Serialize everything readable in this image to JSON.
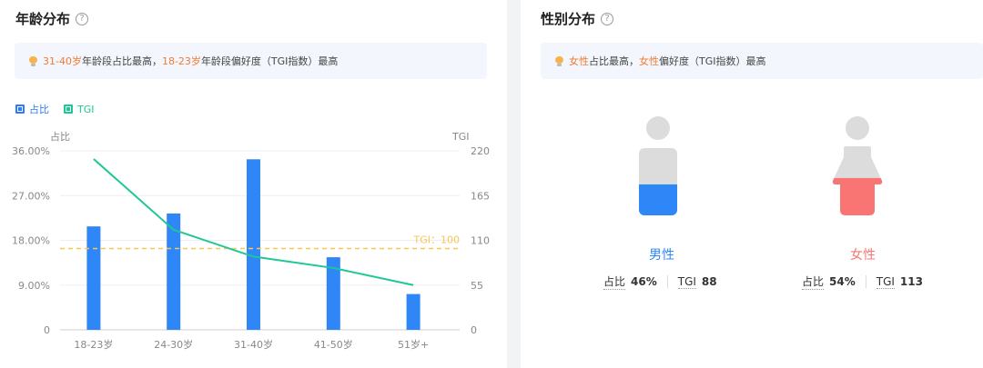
{
  "age_panel": {
    "title": "年龄分布",
    "help_icon": "question-circle-icon",
    "tip": {
      "icon": "lightbulb-icon",
      "hl1": "31-40岁",
      "t1": "年龄段占比最高，",
      "hl2": "18-23岁",
      "t2": "年龄段偏好度（TGI指数）最高"
    },
    "legend": [
      {
        "label": "占比",
        "color": "#2f7cf6"
      },
      {
        "label": "TGI",
        "color": "#1ec796"
      }
    ],
    "left_axis_title": "占比",
    "right_axis_title": "TGI",
    "tgi_ref_label": "TGI：100"
  },
  "gender_panel": {
    "title": "性别分布",
    "help_icon": "question-circle-icon",
    "tip": {
      "icon": "lightbulb-icon",
      "hl1": "女性",
      "t1": "占比最高，",
      "hl2": "女性",
      "t2": "偏好度（TGI指数）最高"
    },
    "male": {
      "label": "男性",
      "share_key": "占比",
      "share": "46%",
      "tgi_key": "TGI",
      "tgi": "88",
      "color": "#2f86f6",
      "share_value": 0.46
    },
    "female": {
      "label": "女性",
      "share_key": "占比",
      "share": "54%",
      "tgi_key": "TGI",
      "tgi": "113",
      "color": "#f87574",
      "share_value": 0.54
    }
  },
  "chart_data": {
    "type": "bar",
    "categories": [
      "18-23岁",
      "24-30岁",
      "31-40岁",
      "41-50岁",
      "51岁+"
    ],
    "series": [
      {
        "name": "占比",
        "type": "bar",
        "axis": "left",
        "color": "#2f86f6",
        "values": [
          20.8,
          23.4,
          34.3,
          14.6,
          7.2
        ]
      },
      {
        "name": "TGI",
        "type": "line",
        "axis": "right",
        "color": "#1ec796",
        "values": [
          210,
          123,
          90,
          76,
          55
        ]
      }
    ],
    "left_axis": {
      "ticks": [
        "0",
        "9.00%",
        "18.00%",
        "27.00%",
        "36.00%"
      ],
      "ylim": [
        0,
        36
      ]
    },
    "right_axis": {
      "ticks": [
        "0",
        "55",
        "110",
        "165",
        "220"
      ],
      "ylim": [
        0,
        220
      ]
    },
    "reference_line": {
      "axis": "right",
      "value": 100,
      "label": "TGI：100",
      "color": "#f7c655"
    },
    "grid": true,
    "legend_position": "top-left"
  }
}
